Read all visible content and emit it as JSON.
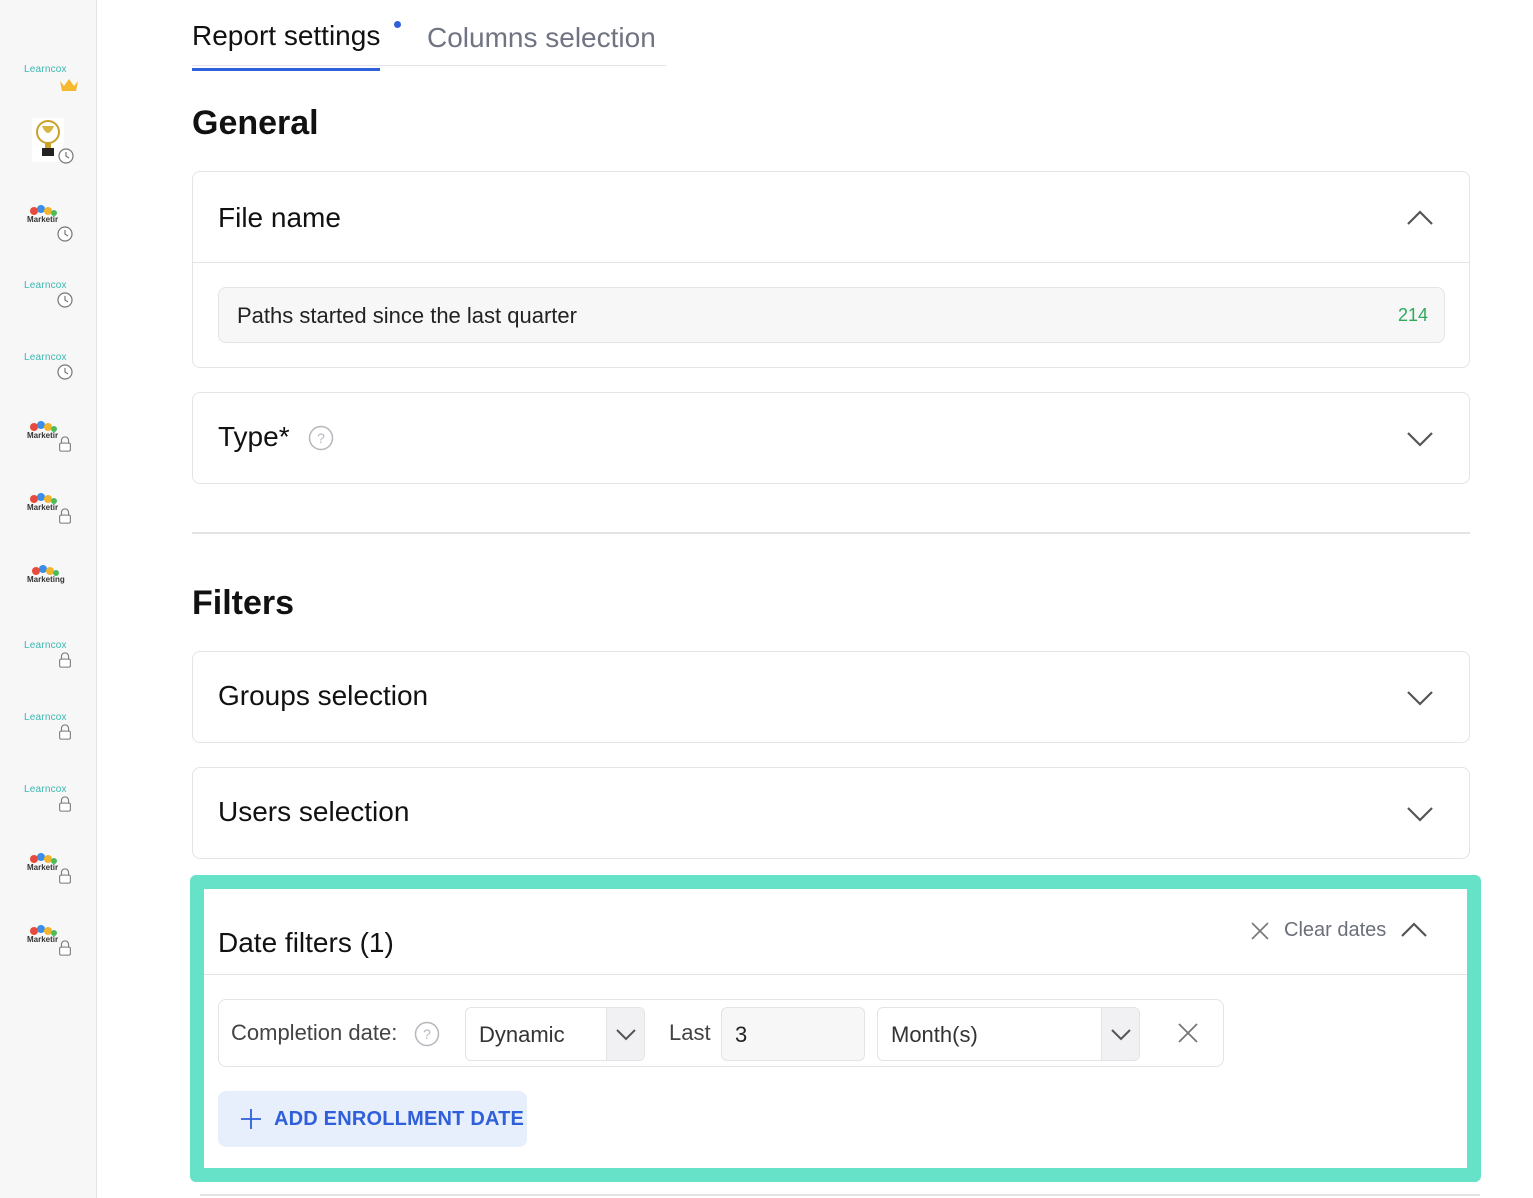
{
  "tabs": {
    "report_settings": "Report settings",
    "columns_selection": "Columns selection"
  },
  "sidebar": {
    "items": [
      {
        "logo": "Learncox",
        "badge": "crown-icon"
      },
      {
        "logo": "trophy",
        "badge": "clock-icon"
      },
      {
        "logo": "Marketir",
        "badge": "clock-icon"
      },
      {
        "logo": "Learncox",
        "badge": "clock-icon"
      },
      {
        "logo": "Learncox",
        "badge": "clock-icon"
      },
      {
        "logo": "Marketir",
        "badge": "lock-icon"
      },
      {
        "logo": "Marketir",
        "badge": "lock-icon"
      },
      {
        "logo": "Marketing",
        "badge": ""
      },
      {
        "logo": "Learncox",
        "badge": "lock-icon"
      },
      {
        "logo": "Learncox",
        "badge": "lock-icon"
      },
      {
        "logo": "Learncox",
        "badge": "lock-icon"
      },
      {
        "logo": "Marketir",
        "badge": "lock-icon"
      },
      {
        "logo": "Marketir",
        "badge": "lock-icon"
      }
    ]
  },
  "general": {
    "title": "General",
    "file_name": {
      "title": "File name",
      "value": "Paths started since the last quarter",
      "remaining_chars": "214"
    },
    "type": {
      "title": "Type*"
    }
  },
  "filters": {
    "title": "Filters",
    "groups": "Groups selection",
    "users": "Users selection",
    "date_filters": {
      "title": "Date filters (1)",
      "clear_label": "Clear dates",
      "row": {
        "label": "Completion date:",
        "mode": "Dynamic",
        "last_label": "Last",
        "amount": "3",
        "unit": "Month(s)"
      },
      "add_button": "ADD ENROLLMENT DATE"
    }
  },
  "colors": {
    "accent": "#2f5fd9",
    "highlight": "#66e2c8",
    "counter": "#2eaa5a"
  }
}
